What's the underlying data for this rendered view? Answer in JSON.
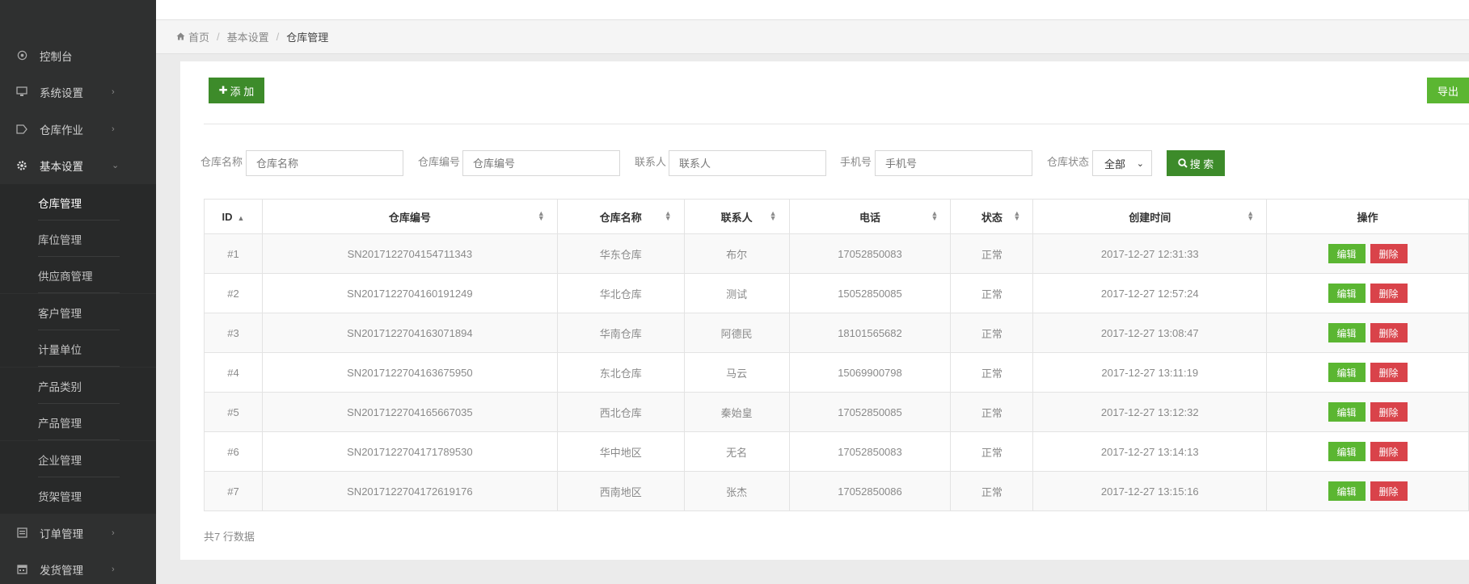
{
  "sidebar": {
    "items": [
      {
        "label": "控制台",
        "icon": "dashboard-icon",
        "has_children": false
      },
      {
        "label": "系统设置",
        "icon": "monitor-icon",
        "has_children": true
      },
      {
        "label": "仓库作业",
        "icon": "tag-icon",
        "has_children": true
      },
      {
        "label": "基本设置",
        "icon": "gear-icon",
        "has_children": true,
        "expanded": true
      }
    ],
    "sub_items": [
      "仓库管理",
      "库位管理",
      "供应商管理",
      "客户管理",
      "计量单位",
      "产品类别",
      "产品管理",
      "企业管理",
      "货架管理"
    ],
    "bottom_items": [
      {
        "label": "订单管理",
        "icon": "document-icon",
        "has_children": true
      },
      {
        "label": "发货管理",
        "icon": "calendar-icon",
        "has_children": true
      }
    ]
  },
  "breadcrumb": {
    "home": "首页",
    "level1": "基本设置",
    "current": "仓库管理"
  },
  "toolbar": {
    "add_label": "添 加",
    "export_label": "导出"
  },
  "filters": {
    "name_label": "仓库名称",
    "name_placeholder": "仓库名称",
    "code_label": "仓库编号",
    "code_placeholder": "仓库编号",
    "contact_label": "联系人",
    "contact_placeholder": "联系人",
    "phone_label": "手机号",
    "phone_placeholder": "手机号",
    "status_label": "仓库状态",
    "status_value": "全部",
    "search_label": "搜 索"
  },
  "table": {
    "columns": [
      "ID",
      "仓库编号",
      "仓库名称",
      "联系人",
      "电话",
      "状态",
      "创建时间",
      "操作"
    ],
    "edit_label": "编辑",
    "delete_label": "删除",
    "rows": [
      {
        "id": "#1",
        "code": "SN2017122704154711343",
        "name": "华东仓库",
        "contact": "布尔",
        "phone": "17052850083",
        "status": "正常",
        "created": "2017-12-27 12:31:33"
      },
      {
        "id": "#2",
        "code": "SN2017122704160191249",
        "name": "华北仓库",
        "contact": "测试",
        "phone": "15052850085",
        "status": "正常",
        "created": "2017-12-27 12:57:24"
      },
      {
        "id": "#3",
        "code": "SN2017122704163071894",
        "name": "华南仓库",
        "contact": "阿德民",
        "phone": "18101565682",
        "status": "正常",
        "created": "2017-12-27 13:08:47"
      },
      {
        "id": "#4",
        "code": "SN2017122704163675950",
        "name": "东北仓库",
        "contact": "马云",
        "phone": "15069900798",
        "status": "正常",
        "created": "2017-12-27 13:11:19"
      },
      {
        "id": "#5",
        "code": "SN2017122704165667035",
        "name": "西北仓库",
        "contact": "秦始皇",
        "phone": "17052850085",
        "status": "正常",
        "created": "2017-12-27 13:12:32"
      },
      {
        "id": "#6",
        "code": "SN2017122704171789530",
        "name": "华中地区",
        "contact": "无名",
        "phone": "17052850083",
        "status": "正常",
        "created": "2017-12-27 13:14:13"
      },
      {
        "id": "#7",
        "code": "SN2017122704172619176",
        "name": "西南地区",
        "contact": "张杰",
        "phone": "17052850086",
        "status": "正常",
        "created": "2017-12-27 13:15:16"
      }
    ]
  },
  "footer": {
    "total_text": "共7 行数据"
  },
  "colors": {
    "sidebar_bg": "#2f3030",
    "primary_green": "#3d8b2a",
    "light_green": "#5bb632",
    "danger_red": "#d9434a"
  }
}
